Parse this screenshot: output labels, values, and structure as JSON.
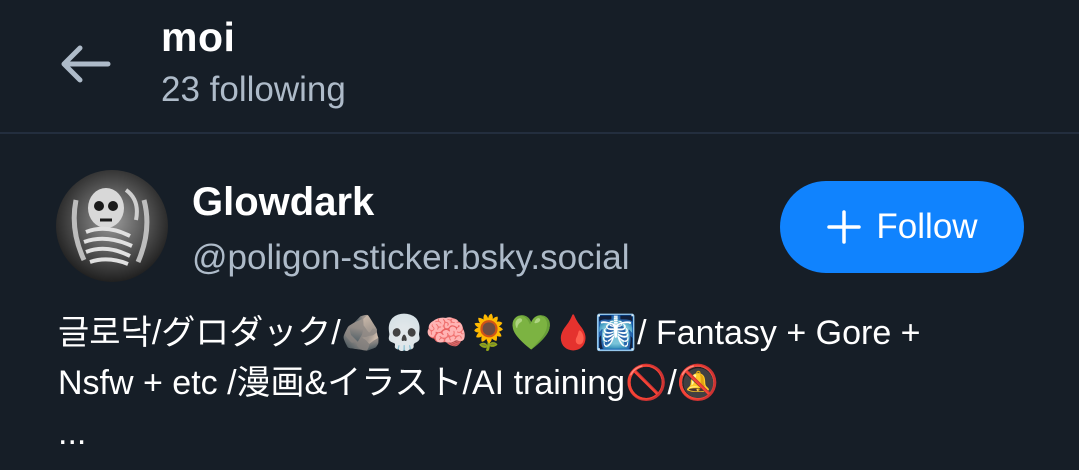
{
  "header": {
    "back_icon": "arrow-left-icon",
    "title": "moi",
    "subtitle": "23 following"
  },
  "profile": {
    "avatar_icon": "skeleton-avatar",
    "display_name": "Glowdark",
    "handle": "@poligon-sticker.bsky.social",
    "follow_label": "Follow",
    "follow_icon": "plus-icon",
    "bio_line1": "글로닥/グロダック/🪨💀🧠🌻💚🩸🩻/ Fantasy + Gore +",
    "bio_line2": "Nsfw + etc /漫画&イラスト/AI training🚫/🔕",
    "bio_more": "..."
  },
  "colors": {
    "background": "#161e27",
    "accent": "#1083fe",
    "muted_text": "#aebbc9",
    "divider": "#232e3e"
  }
}
